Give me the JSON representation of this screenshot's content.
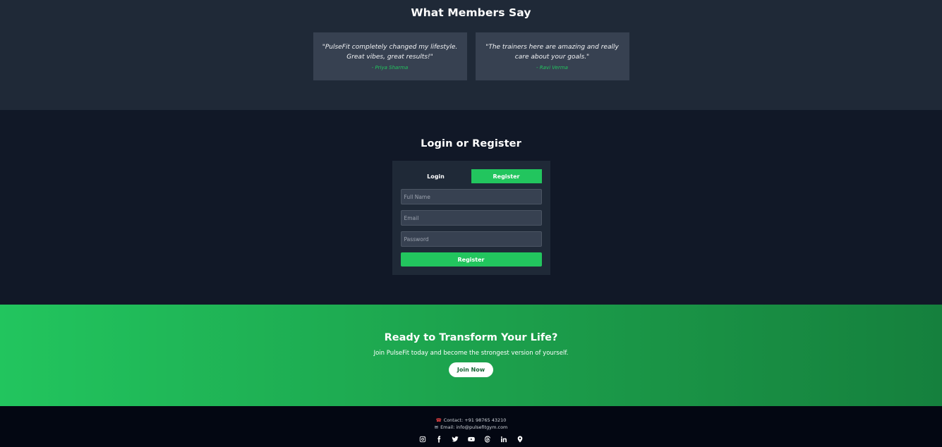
{
  "testimonials": {
    "title": "What Members Say",
    "items": [
      {
        "quote": "\"PulseFit completely changed my lifestyle. Great vibes, great results!\"",
        "author": "- Priya Sharma"
      },
      {
        "quote": "\"The trainers here are amazing and really care about your goals.\"",
        "author": "- Ravi Verma"
      }
    ]
  },
  "auth": {
    "title": "Login or Register",
    "tabs": {
      "login": "Login",
      "register": "Register"
    },
    "active_tab": "register",
    "fields": {
      "full_name_placeholder": "Full Name",
      "email_placeholder": "Email",
      "password_placeholder": "Password"
    },
    "submit_label": "Register"
  },
  "cta": {
    "title": "Ready to Transform Your Life?",
    "text": "Join PulseFit today and become the strongest version of yourself.",
    "button_label": "Join Now"
  },
  "footer": {
    "contact": "Contact: +91 98765 43210",
    "email": "Email: info@pulsefitgym.com",
    "socials": [
      "instagram-icon",
      "facebook-icon",
      "twitter-icon",
      "youtube-icon",
      "threads-icon",
      "linkedin-icon",
      "location-icon"
    ]
  },
  "colors": {
    "accent": "#22c55e",
    "dark_bg": "#111827",
    "section_bg": "#1f2937",
    "card_bg": "#374151",
    "footer_bg": "#030712"
  }
}
